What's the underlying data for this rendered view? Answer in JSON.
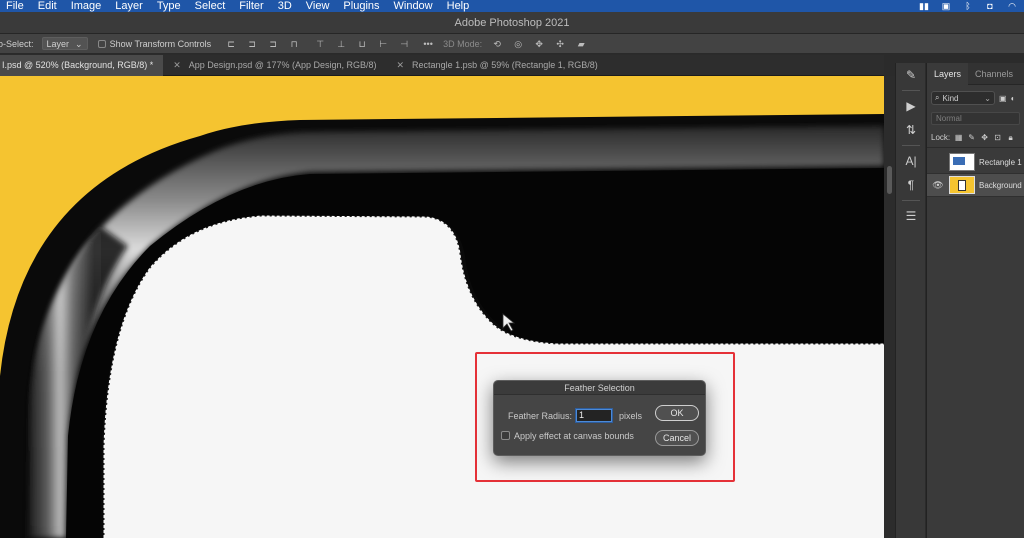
{
  "menubar": {
    "items": [
      "File",
      "Edit",
      "Image",
      "Layer",
      "Type",
      "Select",
      "Filter",
      "3D",
      "View",
      "Plugins",
      "Window",
      "Help"
    ]
  },
  "titlebar": {
    "title": "Adobe Photoshop 2021"
  },
  "options": {
    "auto_select_label": "o-Select:",
    "auto_select_value": "Layer",
    "show_transform_label": "Show Transform Controls",
    "mode_3d_label": "3D Mode:",
    "more_label": "•••"
  },
  "tabs": [
    {
      "label": "I.psd @ 520% (Background, RGB/8) *"
    },
    {
      "label": "App Design.psd @ 177% (App Design, RGB/8)"
    },
    {
      "label": "Rectangle 1.psb @ 59% (Rectangle 1, RGB/8)"
    }
  ],
  "panel": {
    "tabs": [
      "Layers",
      "Channels"
    ],
    "kind_label": "Kind",
    "blend_mode": "Normal",
    "lock_label": "Lock:",
    "layers": [
      {
        "name": "Rectangle 1",
        "selected": false,
        "visible": false
      },
      {
        "name": "Background",
        "selected": true,
        "visible": true
      }
    ]
  },
  "dialog": {
    "title": "Feather Selection",
    "radius_label": "Feather Radius:",
    "radius_value": "1",
    "unit_label": "pixels",
    "ok_label": "OK",
    "cancel_label": "Cancel",
    "apply_label": "Apply effect at canvas bounds",
    "apply_checked": false
  },
  "colors": {
    "menubar": "#1f56a8",
    "canvas_background": "#f5c430",
    "highlight": "#e53138"
  }
}
